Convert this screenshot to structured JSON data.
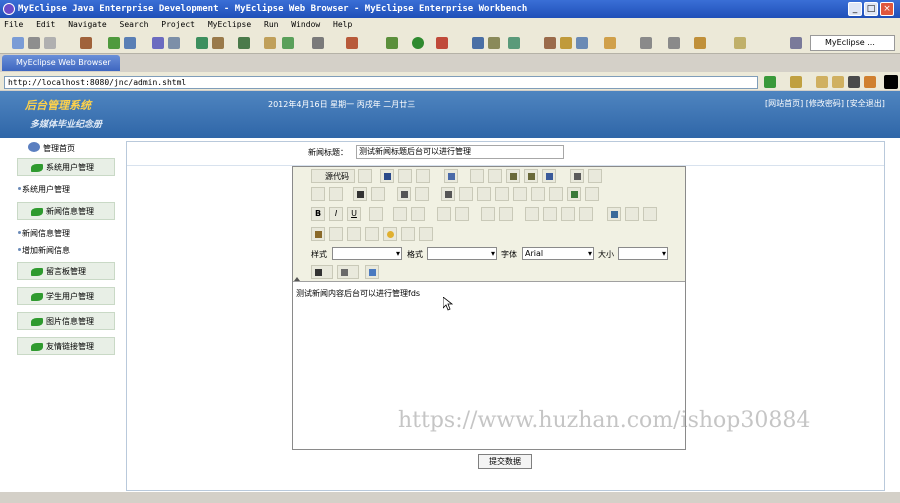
{
  "window": {
    "title": "MyEclipse Java Enterprise Development - MyEclipse Web Browser - MyEclipse Enterprise Workbench",
    "minimize": "_",
    "maximize": "□",
    "close": "×"
  },
  "menubar": {
    "items": [
      "File",
      "Edit",
      "Navigate",
      "Search",
      "Project",
      "MyEclipse",
      "Run",
      "Window",
      "Help"
    ]
  },
  "toolbar": {
    "perspective_label": "MyEclipse ..."
  },
  "browser": {
    "tab_label": "MyEclipse Web Browser",
    "url": "http://localhost:8080/jnc/admin.shtml"
  },
  "site": {
    "brand": "后台管理系统",
    "subtitle": "多媒体毕业纪念册",
    "date": "2012年4月16日 星期一 丙戌年 二月廿三",
    "top_links": "[网站首页] [修改密码] [安全退出]"
  },
  "sidebar": {
    "home": "管理首页",
    "groups": [
      {
        "label": "系统用户管理",
        "subitems": [
          "系统用户管理"
        ]
      },
      {
        "label": "新闻信息管理",
        "subitems": [
          "新闻信息管理",
          "增加新闻信息"
        ]
      },
      {
        "label": "留言板管理",
        "subitems": []
      },
      {
        "label": "学生用户管理",
        "subitems": []
      },
      {
        "label": "图片信息管理",
        "subitems": []
      },
      {
        "label": "友情链接管理",
        "subitems": []
      }
    ]
  },
  "form": {
    "title_label": "新闻标题：",
    "title_value": "测试新闻标题后台可以进行管理",
    "submit_label": "提交数据"
  },
  "editor": {
    "source_label": "源代码",
    "style_label": "样式",
    "format_label": "格式",
    "font_label": "字体",
    "font_value": "Arial",
    "size_label": "大小",
    "content": "测试新闻内容后台可以进行管理fds"
  },
  "watermark": "https://www.huzhan.com/ishop30884"
}
